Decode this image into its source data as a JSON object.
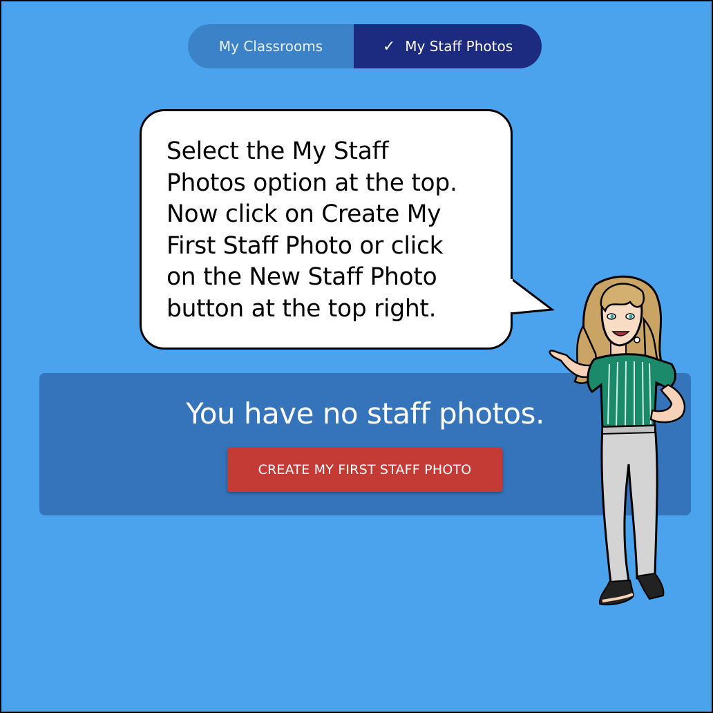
{
  "toggle": {
    "tabs": [
      {
        "label": "My Classrooms",
        "selected": false
      },
      {
        "label": "My Staff Photos",
        "selected": true
      }
    ],
    "check_glyph": "✓"
  },
  "bubble": {
    "lines": [
      "Select the My Staff",
      "Photos option at the top.",
      "Now click on Create My",
      "First Staff Photo or click",
      "on the New Staff Photo",
      "button at the top right."
    ]
  },
  "empty_state": {
    "message": "You have no staff photos.",
    "button_label": "CREATE MY FIRST STAFF PHOTO"
  },
  "colors": {
    "background": "#4aa3ec",
    "tab_inactive": "#3b82c9",
    "tab_active": "#1c2a80",
    "panel": "#3574bb",
    "button": "#c43a34"
  },
  "icons": {
    "check": "check-icon",
    "character": "cartoon-woman-character"
  }
}
